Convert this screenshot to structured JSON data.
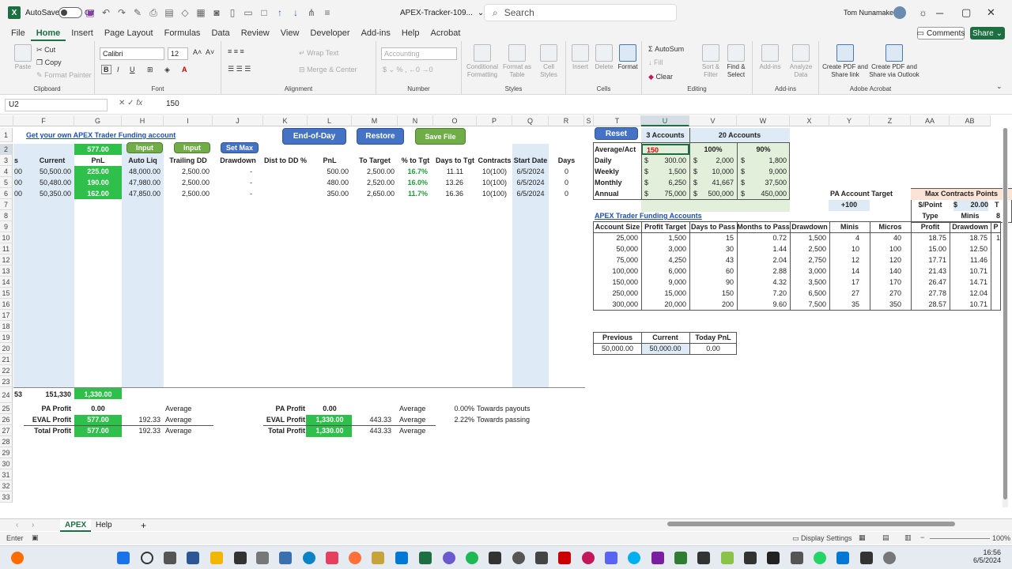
{
  "titlebar": {
    "autosave_label": "AutoSave",
    "autosave_state": "Off",
    "filename": "APEX-Tracker-109...",
    "search_placeholder": "Search",
    "user_name": "Tom Nunamaker"
  },
  "menu": {
    "tabs": [
      "File",
      "Home",
      "Insert",
      "Page Layout",
      "Formulas",
      "Data",
      "Review",
      "View",
      "Developer",
      "Add-ins",
      "Help",
      "Acrobat"
    ],
    "active": "Home",
    "comments": "Comments",
    "share": "Share"
  },
  "ribbon": {
    "paste": "Paste",
    "cut": "Cut",
    "copy": "Copy",
    "format_painter": "Format Painter",
    "clipboard": "Clipboard",
    "font_name": "Calibri",
    "font_size": "12",
    "font_group": "Font",
    "wrap_text": "Wrap Text",
    "merge_center": "Merge & Center",
    "alignment": "Alignment",
    "number_format": "Accounting",
    "number": "Number",
    "cond_format": "Conditional Formatting",
    "format_table": "Format as Table",
    "cell_styles": "Cell Styles",
    "styles": "Styles",
    "insert": "Insert",
    "delete": "Delete",
    "format": "Format",
    "cells": "Cells",
    "autosum": "AutoSum",
    "fill": "Fill",
    "clear": "Clear",
    "sort_filter": "Sort & Filter",
    "find_select": "Find & Select",
    "editing": "Editing",
    "analyze_data": "Analyze Data",
    "addins": "Add-ins",
    "addins_group": "Add-ins",
    "create_pdf_link": "Create PDF and Share link",
    "create_pdf_outlook": "Create PDF and Share via Outlook",
    "adobe": "Adobe Acrobat"
  },
  "formula_bar": {
    "name_box": "U2",
    "value": "150",
    "fx": "fx"
  },
  "columns": [
    "F",
    "G",
    "H",
    "I",
    "J",
    "K",
    "L",
    "M",
    "N",
    "O",
    "P",
    "Q",
    "R",
    "S",
    "T",
    "U",
    "V",
    "W",
    "X",
    "Y",
    "Z",
    "AA",
    "AB"
  ],
  "rows": [
    "1",
    "2",
    "3",
    "4",
    "5",
    "6",
    "7",
    "8",
    "9",
    "10",
    "11",
    "12",
    "13",
    "14",
    "15",
    "16",
    "17",
    "18",
    "19",
    "20",
    "21",
    "22",
    "23",
    "24",
    "25",
    "26",
    "27",
    "28",
    "29",
    "30",
    "31",
    "32",
    "33"
  ],
  "sheet": {
    "link": "Get your own APEX Trader Funding account",
    "g2": "577.00",
    "buttons": {
      "input1": "Input",
      "input2": "Input",
      "set_max": "Set Max",
      "eod": "End-of-Day",
      "restore": "Restore",
      "save_file": "Save File",
      "reset": "Reset"
    },
    "headers": [
      "s",
      "Current",
      "PnL",
      "Auto Liq",
      "Trailing DD",
      "Drawdown",
      "Dist to DD %",
      "PnL",
      "To Target",
      "% to Tgt",
      "Days to Tgt",
      "Contracts",
      "Start Date",
      "Days"
    ],
    "data_rows": [
      [
        "00",
        "50,500.00",
        "225.00",
        "48,000.00",
        "2,500.00",
        "-",
        "",
        "500.00",
        "2,500.00",
        "16.7%",
        "11.11",
        "10(100)",
        "6/5/2024",
        "0"
      ],
      [
        "00",
        "50,480.00",
        "190.00",
        "47,980.00",
        "2,500.00",
        "-",
        "",
        "480.00",
        "2,520.00",
        "16.0%",
        "13.26",
        "10(100)",
        "6/5/2024",
        "0"
      ],
      [
        "00",
        "50,350.00",
        "162.00",
        "47,850.00",
        "2,500.00",
        "-",
        "",
        "350.00",
        "2,650.00",
        "11.7%",
        "16.36",
        "10(100)",
        "6/5/2024",
        "0"
      ]
    ],
    "row24": {
      "f_left": "53",
      "f": "151,330",
      "g": "1,330.00"
    },
    "summary_left": [
      {
        "label": "PA Profit",
        "value": "0.00",
        "avg": "",
        "avg_label": "Average"
      },
      {
        "label": "EVAL Profit",
        "value": "577.00",
        "avg": "192.33",
        "avg_label": "Average"
      },
      {
        "label": "Total Profit",
        "value": "577.00",
        "avg": "192.33",
        "avg_label": "Average"
      }
    ],
    "summary_right": [
      {
        "label": "PA Profit",
        "value": "0.00",
        "avg": "",
        "avg_label": "Average",
        "pct": "0.00%",
        "note": "Towards payouts"
      },
      {
        "label": "EVAL Profit",
        "value": "1,330.00",
        "avg": "443.33",
        "avg_label": "Average",
        "pct": "2.22%",
        "note": "Towards passing"
      },
      {
        "label": "Total Profit",
        "value": "1,330.00",
        "avg": "443.33",
        "avg_label": "Average",
        "pct": "",
        "note": ""
      }
    ],
    "accounts": {
      "u1": "3 Accounts",
      "v1": "20 Accounts",
      "avg_label": "Average/Act",
      "u2": "150",
      "v2": "100%",
      "w2": "90%",
      "rows": [
        {
          "label": "Daily",
          "u": "300.00",
          "v": "2,000",
          "w": "1,800"
        },
        {
          "label": "Weekly",
          "u": "1,500",
          "v": "10,000",
          "w": "9,000"
        },
        {
          "label": "Monthly",
          "u": "6,250",
          "v": "41,667",
          "w": "37,500"
        },
        {
          "label": "Annual",
          "u": "75,000",
          "v": "500,000",
          "w": "450,000"
        }
      ],
      "dollar": "$"
    },
    "pa_target": {
      "label": "PA Account Target",
      "value": "+100"
    },
    "max_contracts": {
      "title": "Max Contracts Points",
      "per_point": "$/Point",
      "dollar": "$",
      "per_point_value": "20.00",
      "t": "T",
      "type": "Type",
      "minis": "Minis",
      "eight": "8"
    },
    "funding_title": "APEX Trader Funding Accounts",
    "funding_headers": [
      "Account Size",
      "Profit Target",
      "Days to Pass",
      "Months to Pass",
      "Drawdown",
      "Minis",
      "Micros",
      "Profit",
      "Drawdown",
      "P"
    ],
    "funding_rows": [
      [
        "25,000",
        "1,500",
        "15",
        "0.72",
        "1,500",
        "4",
        "40",
        "18.75",
        "18.75",
        "1"
      ],
      [
        "50,000",
        "3,000",
        "30",
        "1.44",
        "2,500",
        "10",
        "100",
        "15.00",
        "12.50",
        ""
      ],
      [
        "75,000",
        "4,250",
        "43",
        "2.04",
        "2,750",
        "12",
        "120",
        "17.71",
        "11.46",
        ""
      ],
      [
        "100,000",
        "6,000",
        "60",
        "2.88",
        "3,000",
        "14",
        "140",
        "21.43",
        "10.71",
        ""
      ],
      [
        "150,000",
        "9,000",
        "90",
        "4.32",
        "3,500",
        "17",
        "170",
        "26.47",
        "14.71",
        ""
      ],
      [
        "250,000",
        "15,000",
        "150",
        "7.20",
        "6,500",
        "27",
        "270",
        "27.78",
        "12.04",
        ""
      ],
      [
        "300,000",
        "20,000",
        "200",
        "9.60",
        "7,500",
        "35",
        "350",
        "28.57",
        "10.71",
        ""
      ]
    ],
    "pnl_box": {
      "headers": [
        "Previous",
        "Current",
        "Today PnL"
      ],
      "values": [
        "50,000.00",
        "50,000.00",
        "0.00"
      ]
    }
  },
  "sheet_tabs": [
    "APEX",
    "Help"
  ],
  "status": {
    "mode": "Enter",
    "display_settings": "Display Settings",
    "zoom": "100%"
  },
  "clock": {
    "time": "16:56",
    "date": "6/5/2024"
  }
}
